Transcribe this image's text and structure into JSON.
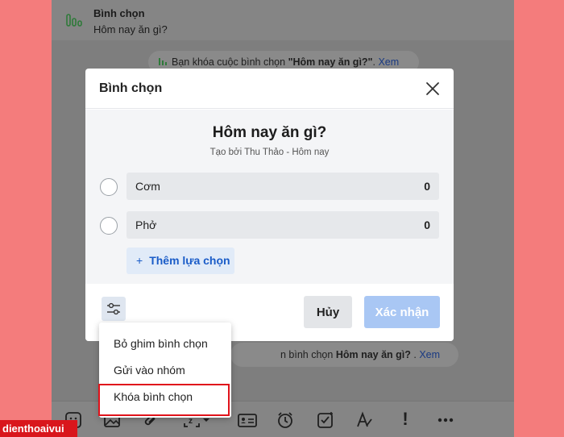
{
  "pinned": {
    "title": "Bình chọn",
    "subtitle": "Hôm nay ăn gì?"
  },
  "system_message_top": {
    "prefix": "Bạn khóa cuộc bình chọn ",
    "poll_name": "\"Hôm nay ăn gì?\"",
    "suffix": ". ",
    "link": "Xem"
  },
  "system_message_bottom": {
    "prefix": "n bình chọn ",
    "poll_name": "Hôm nay ăn gì?",
    "suffix": " . ",
    "link": "Xem"
  },
  "modal": {
    "title": "Bình chọn",
    "question": "Hôm nay ăn gì?",
    "creator": "Tạo bởi Thu Thảo - Hôm nay",
    "options": [
      {
        "label": "Cơm",
        "count": "0"
      },
      {
        "label": "Phở",
        "count": "0"
      }
    ],
    "add_option_label": "Thêm lựa chọn",
    "add_option_plus": "+",
    "cancel_label": "Hủy",
    "confirm_label": "Xác nhận"
  },
  "menu": {
    "items": [
      {
        "label": "Bỏ ghim bình chọn"
      },
      {
        "label": "Gửi vào nhóm"
      },
      {
        "label": "Khóa bình chọn"
      }
    ],
    "highlighted_index": 2
  },
  "toolbar": {
    "icons": [
      "sticker-icon",
      "image-icon",
      "attachment-icon",
      "screenshot-icon",
      "contact-card-icon",
      "reminder-icon",
      "task-icon",
      "format-text-icon",
      "urgent-icon",
      "more-icon"
    ],
    "urgent_glyph": "!"
  },
  "watermark": "dienthoaivui",
  "colors": {
    "background": "#f47c7c",
    "accent": "#1a5cc8",
    "confirm_disabled": "#a9c7f4",
    "highlight": "#e0131b"
  }
}
